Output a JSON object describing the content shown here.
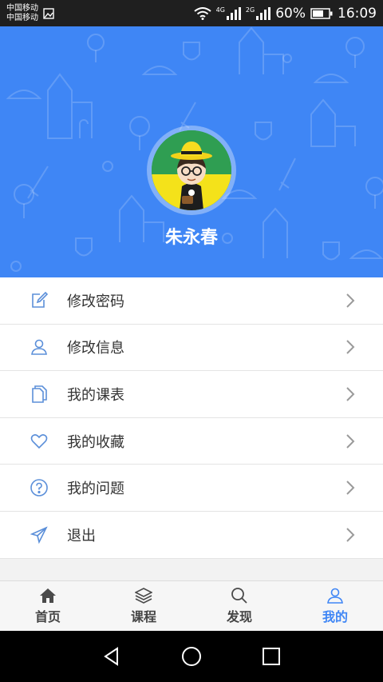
{
  "status_bar": {
    "carrier1": "中国移动",
    "carrier2": "中国移动",
    "net1": "4G",
    "net2": "2G",
    "battery": "60%",
    "time": "16:09"
  },
  "profile": {
    "name": "朱永春"
  },
  "menu": {
    "items": [
      {
        "label": "修改密码",
        "icon": "edit-icon"
      },
      {
        "label": "修改信息",
        "icon": "user-icon"
      },
      {
        "label": "我的课表",
        "icon": "document-icon"
      },
      {
        "label": "我的收藏",
        "icon": "heart-icon"
      },
      {
        "label": "我的问题",
        "icon": "question-icon"
      },
      {
        "label": "退出",
        "icon": "send-icon"
      }
    ]
  },
  "tabs": [
    {
      "label": "首页",
      "icon": "home-icon",
      "active": false
    },
    {
      "label": "课程",
      "icon": "layers-icon",
      "active": false
    },
    {
      "label": "发现",
      "icon": "search-icon",
      "active": false
    },
    {
      "label": "我的",
      "icon": "user-icon",
      "active": true
    }
  ],
  "colors": {
    "accent": "#3f86f5",
    "header_bg": "#3f86f5",
    "icon_blue": "#5b8fd9"
  }
}
